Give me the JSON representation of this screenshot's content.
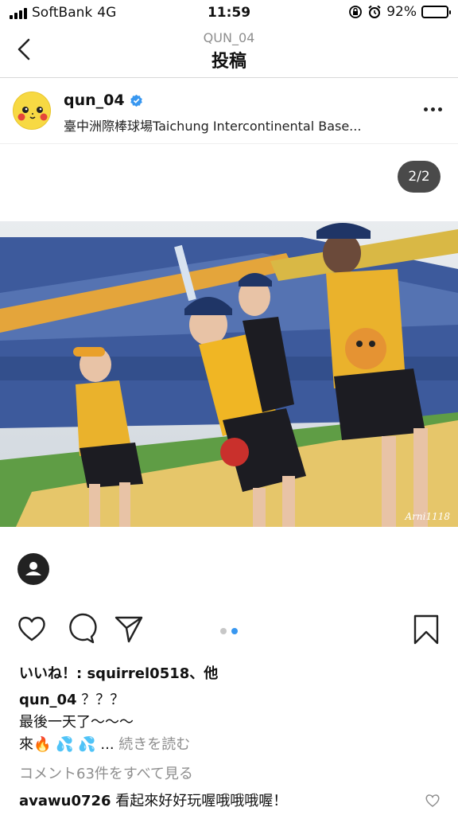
{
  "status_bar": {
    "carrier": "SoftBank",
    "network": "4G",
    "time": "11:59",
    "battery_percent": "92%",
    "battery_level": 0.92
  },
  "header": {
    "subtitle": "QUN_04",
    "title": "投稿"
  },
  "post": {
    "username": "qun_04",
    "verified": true,
    "location": "臺中洲際棒球場Taichung Intercontinental Base...",
    "carousel_counter": "2/2",
    "carousel_total": 2,
    "carousel_active": 2,
    "photo_watermark": "Arni1118",
    "photo_icon": "people-photo"
  },
  "actions": {
    "like_icon": "heart-icon",
    "comment_icon": "comment-icon",
    "share_icon": "send-icon",
    "save_icon": "bookmark-icon"
  },
  "likes": {
    "prefix": "いいね！: ",
    "user": "squirrel0518",
    "suffix": "、他"
  },
  "caption": {
    "username": "qun_04",
    "text_line1": " ？？？",
    "text_line2": "最後一天了〜〜〜",
    "text_line3": "來🔥 💦 💦 ...",
    "read_more": " 続きを読む"
  },
  "comments": {
    "view_all": "コメント63件をすべて見る",
    "first_user": "avawu0726",
    "first_text": " 看起來好好玩喔哦哦哦喔！"
  },
  "colors": {
    "accent_blue": "#3897f0",
    "muted_gray": "#8e8e8e",
    "counter_bg": "#4a4a4a"
  }
}
